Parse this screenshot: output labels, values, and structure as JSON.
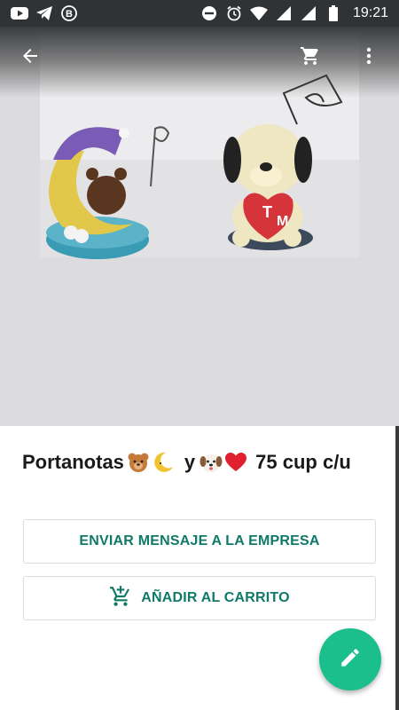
{
  "status_bar": {
    "time": "19:21",
    "left_icons": [
      "youtube-icon",
      "telegram-icon",
      "b-circle-icon"
    ],
    "right_icons": [
      "do-not-disturb-icon",
      "alarm-icon",
      "wifi-icon",
      "signal-icon",
      "signal-icon",
      "battery-icon"
    ]
  },
  "app_bar": {
    "back_icon": "arrow-left-icon",
    "cart_icon": "shopping-cart-icon",
    "more_icon": "more-vertical-icon"
  },
  "product": {
    "title_part1": "Portanotas",
    "title_part2": "y",
    "title_part3": "75 cup c/u",
    "emojis": [
      "bear-face-emoji",
      "crescent-moon-emoji",
      "dog-face-emoji",
      "red-heart-emoji"
    ]
  },
  "actions": {
    "message_label": "ENVIAR MENSAJE A LA EMPRESA",
    "cart_label": "AÑADIR AL CARRITO",
    "cart_icon": "add-to-cart-icon"
  },
  "fab": {
    "icon": "pencil-icon"
  },
  "colors": {
    "accent": "#0f7a67",
    "fab": "#1bbf8b",
    "status_bar": "#2f3336"
  }
}
